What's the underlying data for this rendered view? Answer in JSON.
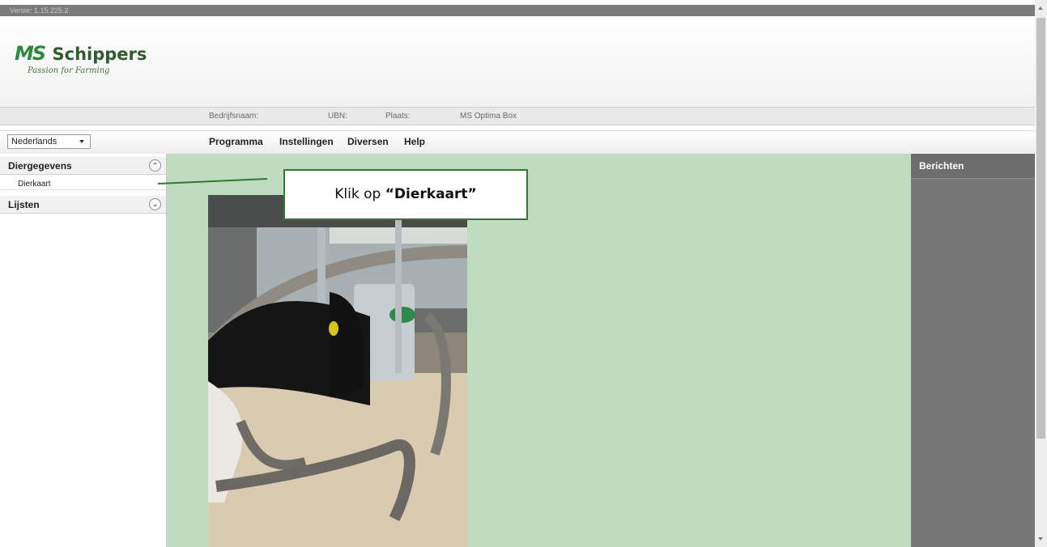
{
  "version_text": "Versie: 1.15.225.2",
  "brand": {
    "mark": "MS",
    "name": "Schippers",
    "tagline": "Passion for Farming"
  },
  "infobar": {
    "company_label": "Bedrijfsnaam:",
    "ubn_label": "UBN:",
    "place_label": "Plaats:",
    "product": "MS Optima Box"
  },
  "language": {
    "selected": "Nederlands"
  },
  "menu": [
    "Programma",
    "Instellingen",
    "Diversen",
    "Help"
  ],
  "sidebar": {
    "sections": [
      {
        "label": "Diergegevens",
        "expanded": true,
        "icon": "chevron-up-icon",
        "items": [
          "Dierkaart"
        ]
      },
      {
        "label": "Lijsten",
        "expanded": false,
        "icon": "chevron-down-icon",
        "items": []
      }
    ]
  },
  "callout": {
    "prefix": "Klik op ",
    "emphasis": "“Dierkaart”"
  },
  "right_panel": {
    "title": "Berichten"
  },
  "colors": {
    "content_bg": "#c0dcc0",
    "accent_green": "#2f7a2f",
    "panel_gray": "#777777"
  }
}
